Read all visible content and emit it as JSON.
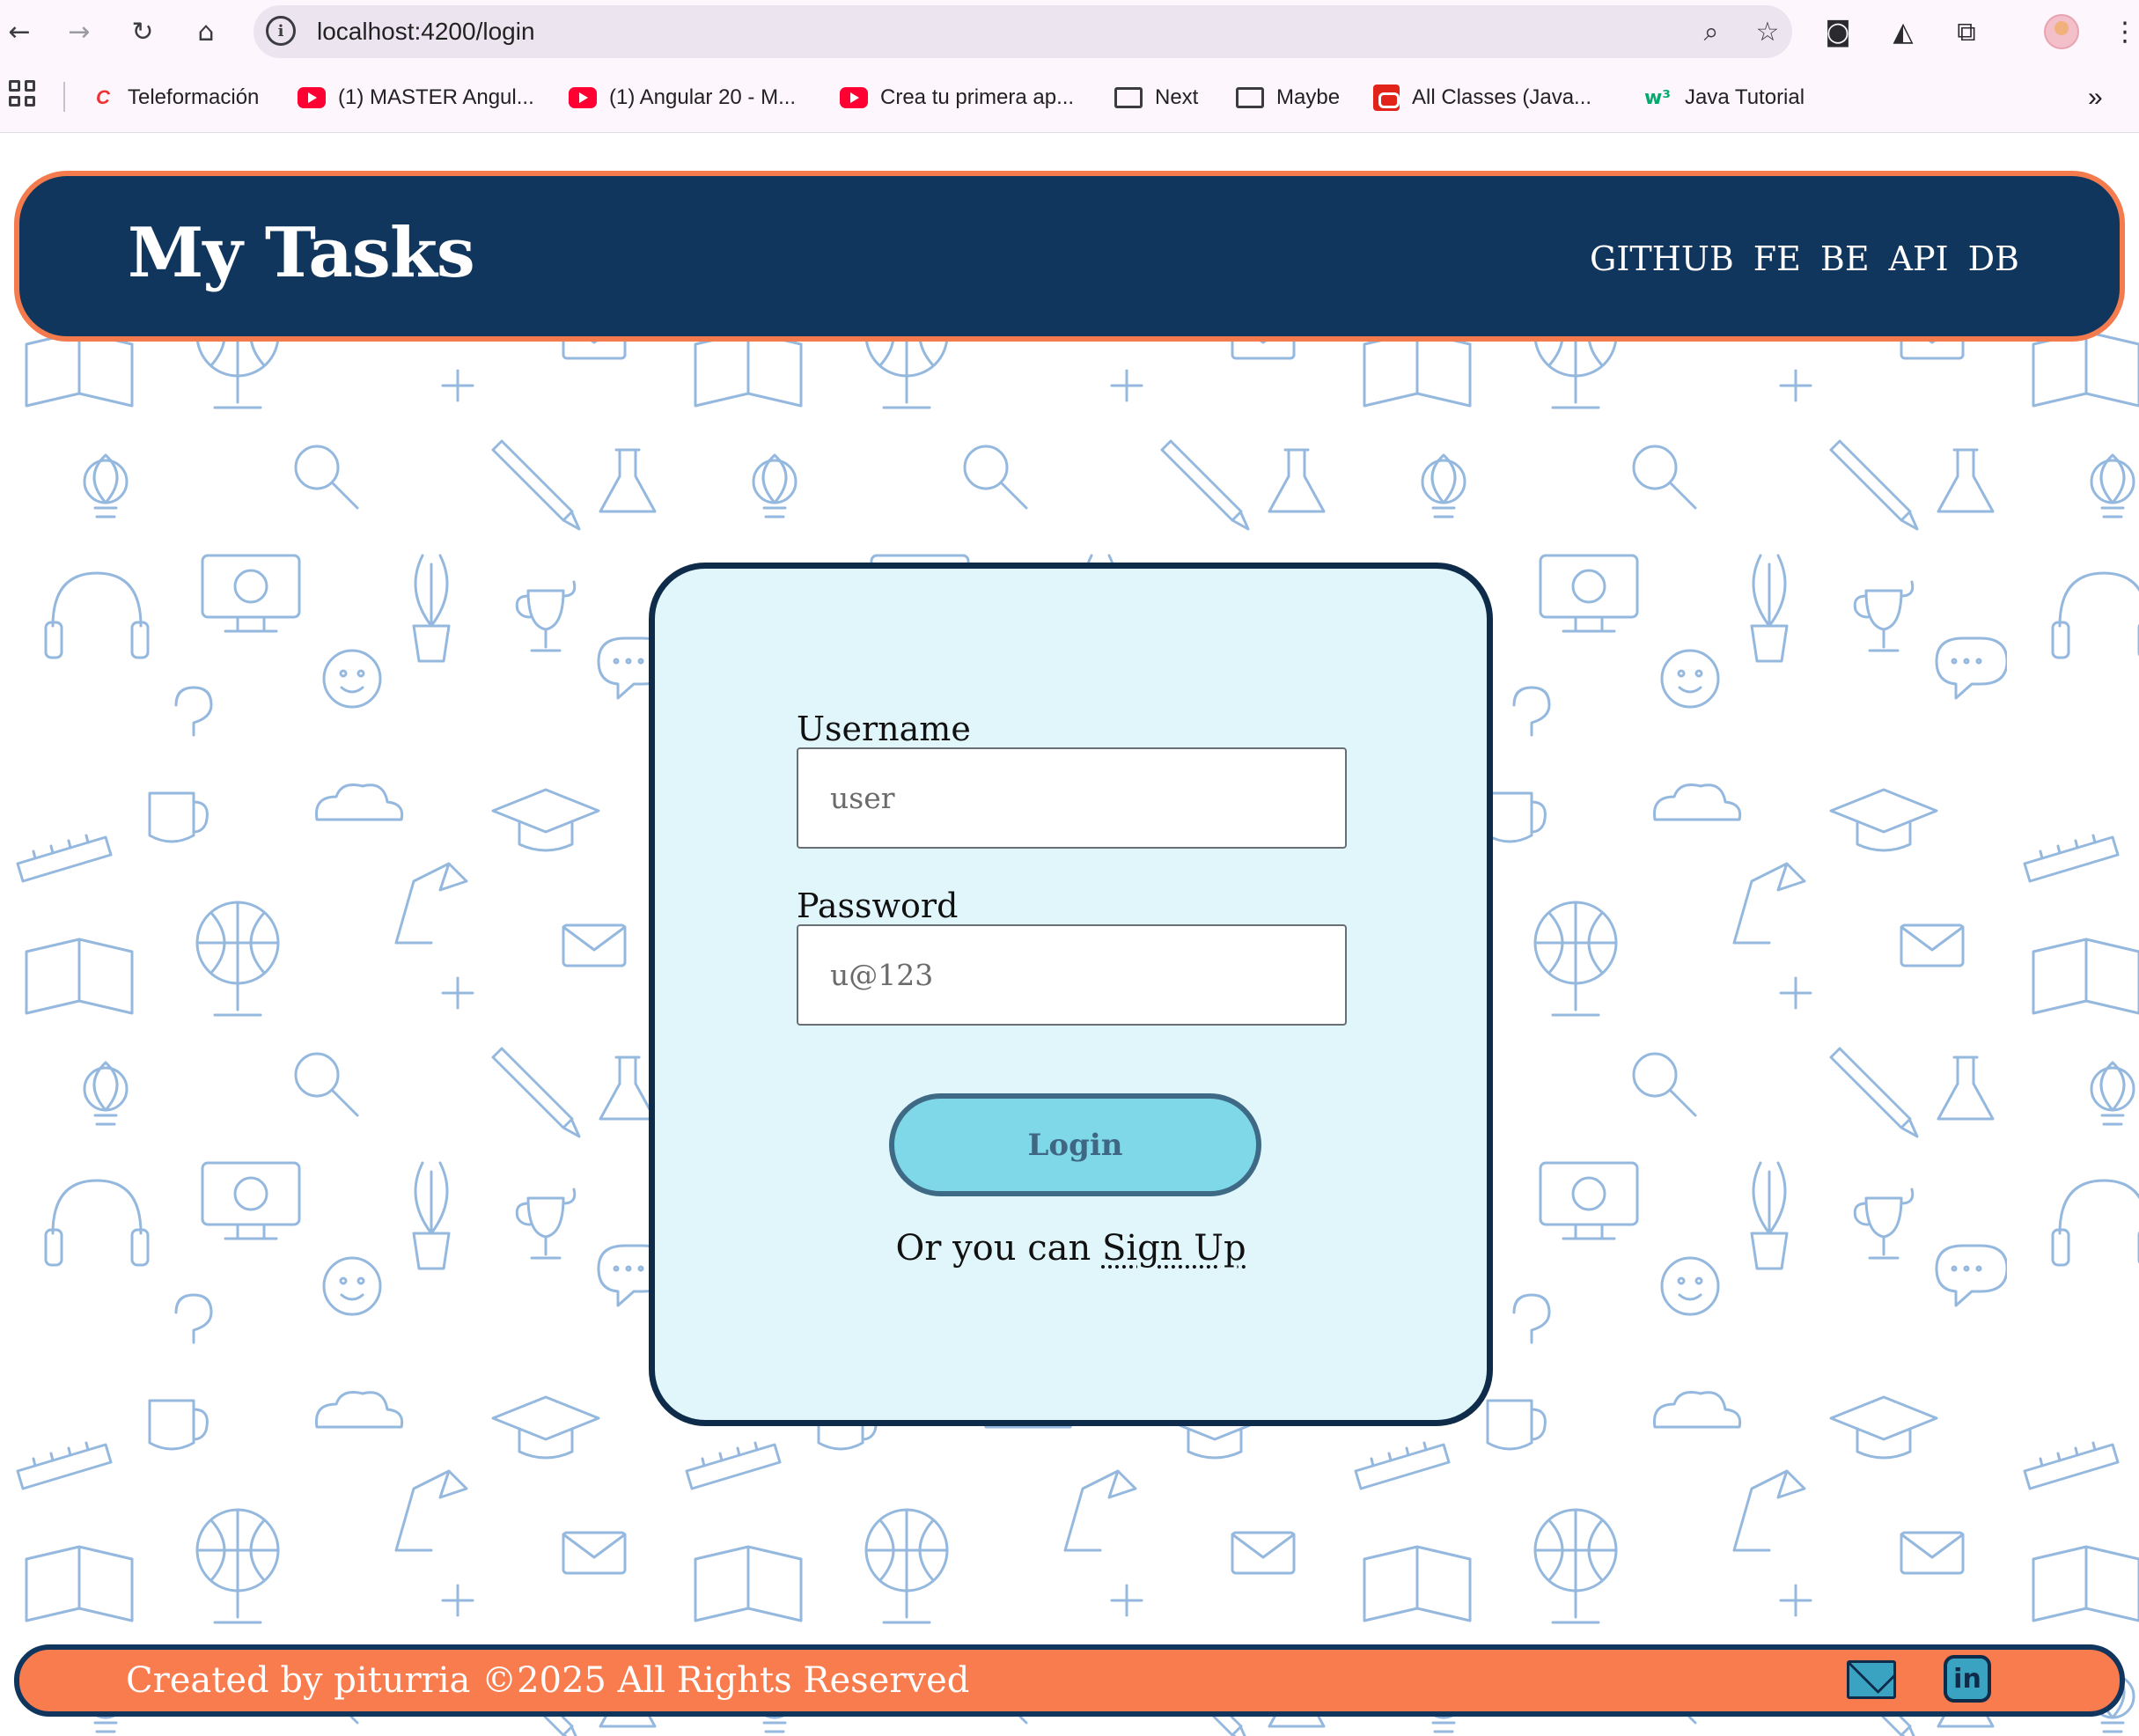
{
  "browser": {
    "url": "localhost:4200/login",
    "bookmarks": [
      {
        "label": "Teleformación",
        "icon": "c-icon"
      },
      {
        "label": "(1) MASTER Angul...",
        "icon": "youtube-icon"
      },
      {
        "label": "(1) Angular 20 - M...",
        "icon": "youtube-icon"
      },
      {
        "label": "Crea tu primera ap...",
        "icon": "youtube-icon"
      },
      {
        "label": "Next",
        "icon": "folder-icon"
      },
      {
        "label": "Maybe",
        "icon": "folder-icon"
      },
      {
        "label": "All Classes (Java...",
        "icon": "oracle-icon"
      },
      {
        "label": "Java Tutorial",
        "icon": "w3schools-icon"
      }
    ],
    "more_bookmarks": "»"
  },
  "header": {
    "title": "My Tasks",
    "nav": [
      "GITHUB",
      "FE",
      "BE",
      "API",
      "DB"
    ]
  },
  "login": {
    "username_label": "Username",
    "username_placeholder": "user",
    "password_label": "Password",
    "password_placeholder": "u@123",
    "button_label": "Login",
    "signup_prefix": "Or you can",
    "signup_link": "Sign Up"
  },
  "footer": {
    "text": "Created by piturria ©2025 All Rights Reserved",
    "linkedin_label": "in"
  },
  "colors": {
    "header_bg": "#10365e",
    "accent_orange": "#f47b4e",
    "card_bg": "#e0f6fb",
    "button_bg": "#7fd8e8",
    "doodle_stroke": "#8fb4dc"
  }
}
